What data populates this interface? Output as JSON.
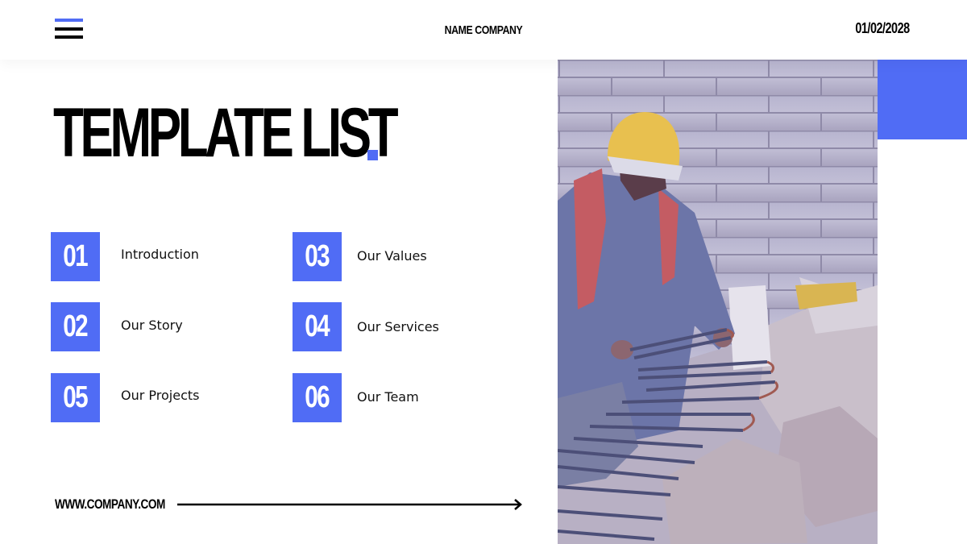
{
  "header": {
    "menu_icon": "hamburger-menu-icon",
    "company_name": "NAME COMPANY",
    "date": "01/02/2028"
  },
  "main": {
    "title": "TEMPLATE LIST",
    "items": [
      {
        "number": "01",
        "label": "Introduction"
      },
      {
        "number": "02",
        "label": "Our Story"
      },
      {
        "number": "05",
        "label": "Our Projects"
      },
      {
        "number": "03",
        "label": "Our Values"
      },
      {
        "number": "04",
        "label": "Our Services"
      },
      {
        "number": "06",
        "label": "Our Team"
      }
    ]
  },
  "footer": {
    "url": "WWW.COMPANY.COM",
    "arrow_icon": "right-arrow-icon"
  },
  "photo": {
    "description": "Construction worker in yellow hard hat and plaid shirt bending over bundles of steel rebar beside rocks and a cinder block wall"
  },
  "colors": {
    "accent": "#506cf5",
    "text": "#000000",
    "background": "#ffffff"
  }
}
